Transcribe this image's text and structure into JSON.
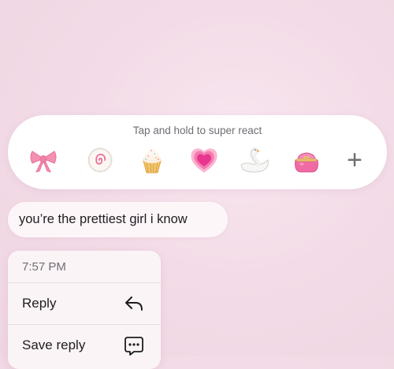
{
  "reaction_bar": {
    "hint": "Tap and hold to super react",
    "reactions": [
      {
        "icon": "pink-bow-icon"
      },
      {
        "icon": "fish-cake-icon"
      },
      {
        "icon": "cupcake-icon"
      },
      {
        "icon": "growing-heart-icon"
      },
      {
        "icon": "swan-icon"
      },
      {
        "icon": "pink-purse-icon"
      }
    ],
    "more_icon": "plus-icon"
  },
  "message": {
    "text": "you’re the prettiest girl i know"
  },
  "context_menu": {
    "time": "7:57 PM",
    "items": [
      {
        "label": "Reply",
        "icon": "reply-arrow-icon"
      },
      {
        "label": "Save reply",
        "icon": "save-reply-icon"
      }
    ]
  },
  "colors": {
    "background": "#f3dce7",
    "bow": "#f48fb1",
    "heart": "#e8368f",
    "purse": "#f06ba4"
  }
}
